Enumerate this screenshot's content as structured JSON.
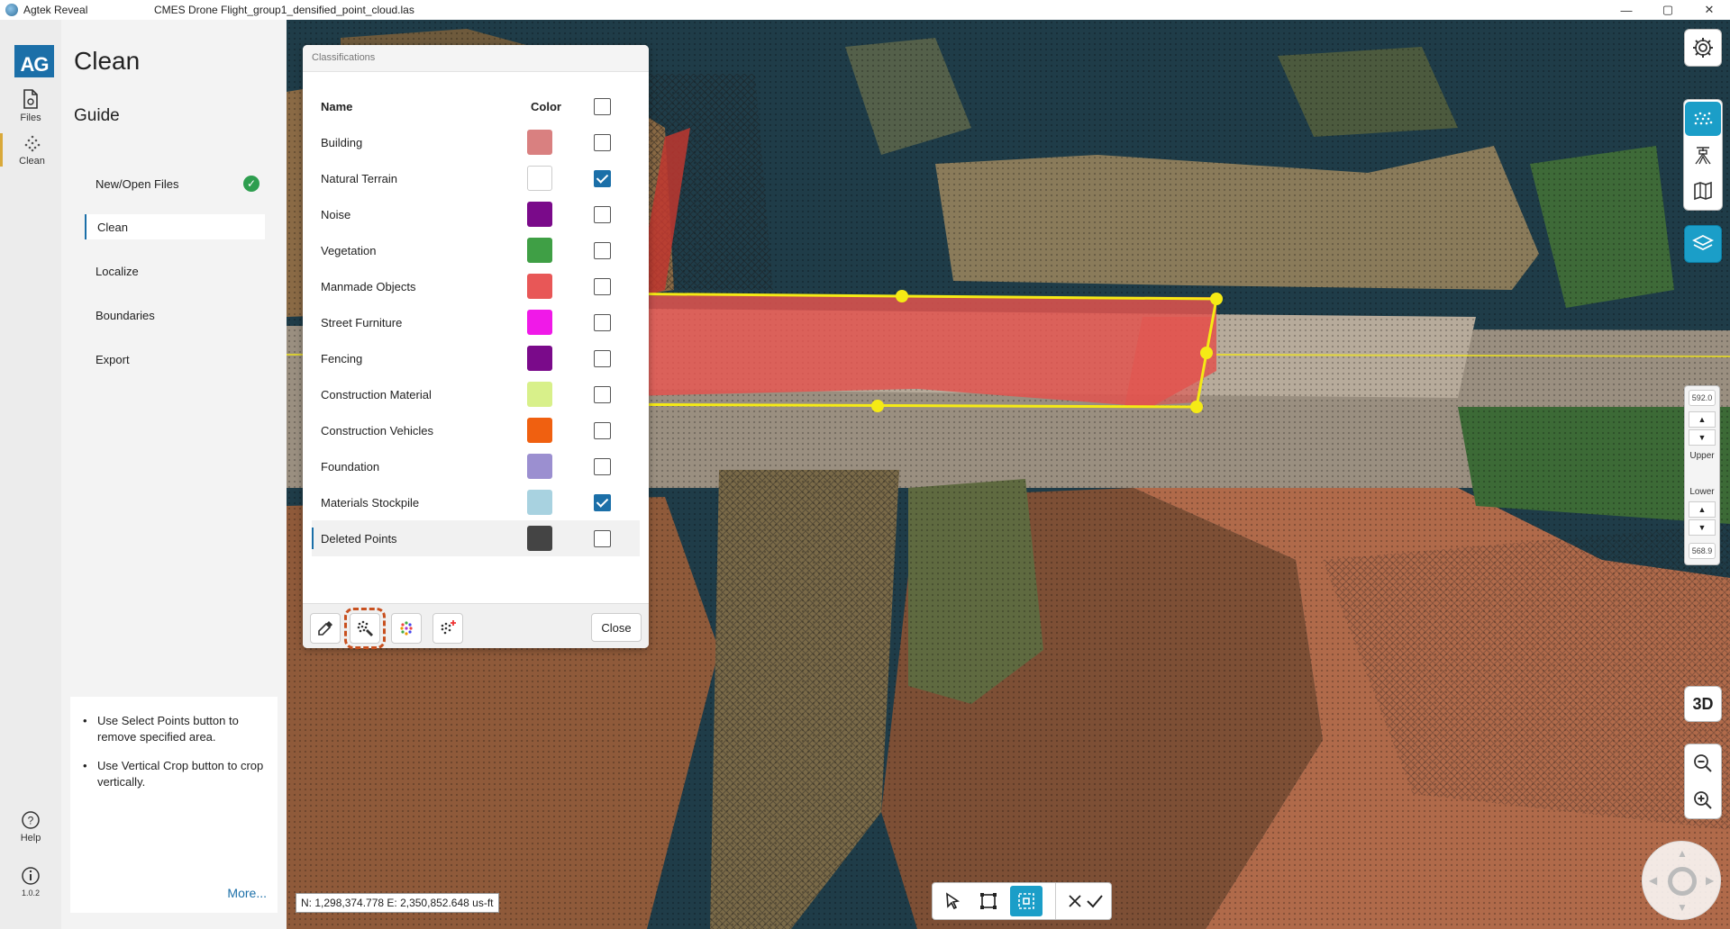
{
  "titlebar": {
    "app_name": "Agtek Reveal",
    "file_name": "CMES Drone Flight_group1_densified_point_cloud.las",
    "minimize": "—",
    "maximize": "▢",
    "close": "✕"
  },
  "rail": {
    "logo": "AG",
    "files_label": "Files",
    "clean_label": "Clean",
    "help_label": "Help",
    "version_label": "1.0.2"
  },
  "guide": {
    "title": "Clean",
    "subtitle": "Guide",
    "steps": [
      {
        "label": "New/Open Files",
        "done": true
      },
      {
        "label": "Clean",
        "active": true
      },
      {
        "label": "Localize"
      },
      {
        "label": "Boundaries"
      },
      {
        "label": "Export"
      }
    ],
    "check_mark": "✓",
    "tips": [
      "Use Select Points button to remove specified area.",
      "Use Vertical Crop button to crop vertically."
    ],
    "more_link": "More..."
  },
  "classifications": {
    "title": "Classifications",
    "header_name": "Name",
    "header_color": "Color",
    "rows": [
      {
        "name": "Building",
        "color": "#d98080",
        "checked": false
      },
      {
        "name": "Natural Terrain",
        "color": "#ffffff",
        "checked": true
      },
      {
        "name": "Noise",
        "color": "#7a0a8a",
        "checked": false
      },
      {
        "name": "Vegetation",
        "color": "#3f9f45",
        "checked": false
      },
      {
        "name": "Manmade Objects",
        "color": "#e85757",
        "checked": false
      },
      {
        "name": "Street Furniture",
        "color": "#f019e8",
        "checked": false
      },
      {
        "name": "Fencing",
        "color": "#7a0a8a",
        "checked": false
      },
      {
        "name": "Construction Material",
        "color": "#d8f08a",
        "checked": false
      },
      {
        "name": "Construction Vehicles",
        "color": "#f06010",
        "checked": false
      },
      {
        "name": "Foundation",
        "color": "#9b8fd0",
        "checked": false
      },
      {
        "name": "Materials Stockpile",
        "color": "#a8d2e0",
        "checked": true
      },
      {
        "name": "Deleted Points",
        "color": "#444444",
        "checked": false,
        "selected": true
      }
    ],
    "close_label": "Close"
  },
  "right_panel": {
    "upper_value": "592.0",
    "upper_label": "Upper",
    "lower_label": "Lower",
    "lower_value": "568.9",
    "three_d_label": "3D",
    "arrow_up": "▲",
    "arrow_down": "▼"
  },
  "status": {
    "coordinates": "N: 1,298,374.778 E: 2,350,852.648 us-ft"
  },
  "colors": {
    "accent": "#1b9ec8",
    "brand": "#1b6fa8",
    "selection_outline": "#f5ea15",
    "selection_fill": "#e2544f"
  }
}
